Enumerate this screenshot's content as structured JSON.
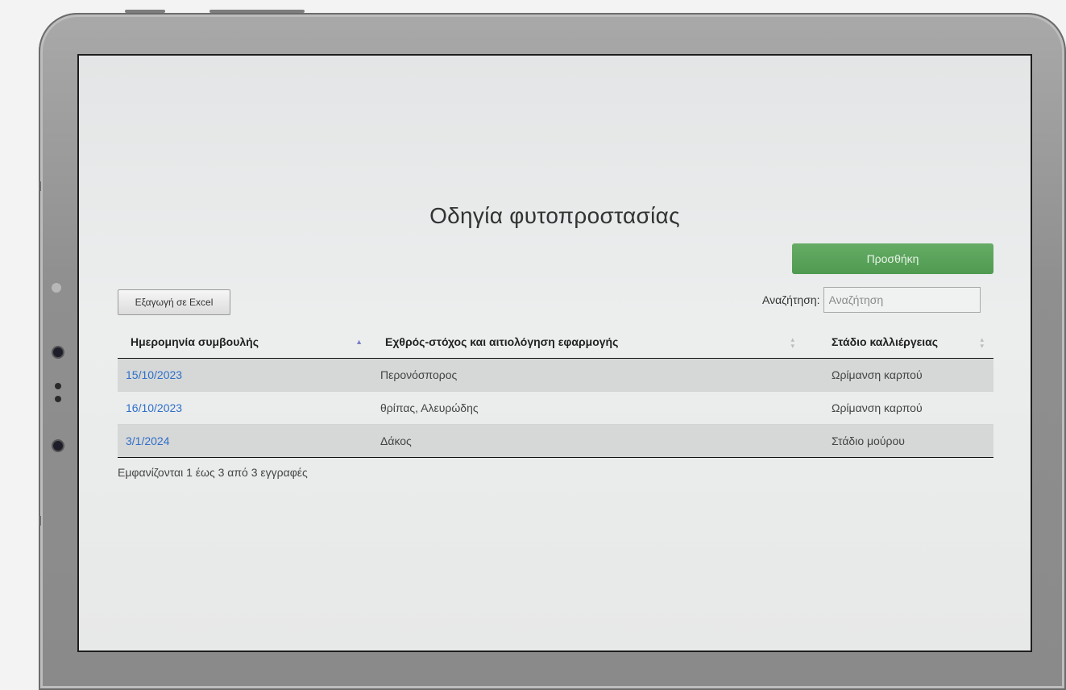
{
  "page": {
    "title": "Οδηγία φυτοπροστασίας"
  },
  "toolbar": {
    "add_label": "Προσθήκη",
    "export_label": "Εξαγωγή σε Excel",
    "search_label": "Αναζήτηση:",
    "search_placeholder": "Αναζήτηση",
    "search_value": ""
  },
  "table": {
    "headers": [
      "Ημερομηνία συμβουλής",
      "Εχθρός-στόχος και αιτιολόγηση εφαρμογής",
      "Στάδιο καλλιέργειας"
    ],
    "rows": [
      {
        "date": "15/10/2023",
        "target": "Περονόσπορος",
        "stage": "Ωρίμανση καρπού"
      },
      {
        "date": "16/10/2023",
        "target": "θρίπας, Αλευρώδης",
        "stage": "Ωρίμανση καρπού"
      },
      {
        "date": "3/1/2024",
        "target": "Δάκος",
        "stage": "Στάδιο μούρου"
      }
    ]
  },
  "footer": {
    "info": "Εμφανίζονται 1 έως 3 από 3 εγγραφές"
  },
  "icons": {
    "sort_active": "sort-asc-icon",
    "sort_inactive": "sort-both-icon"
  },
  "colors": {
    "accent_green": "#5aa35c",
    "link_blue": "#2e6fc8"
  }
}
